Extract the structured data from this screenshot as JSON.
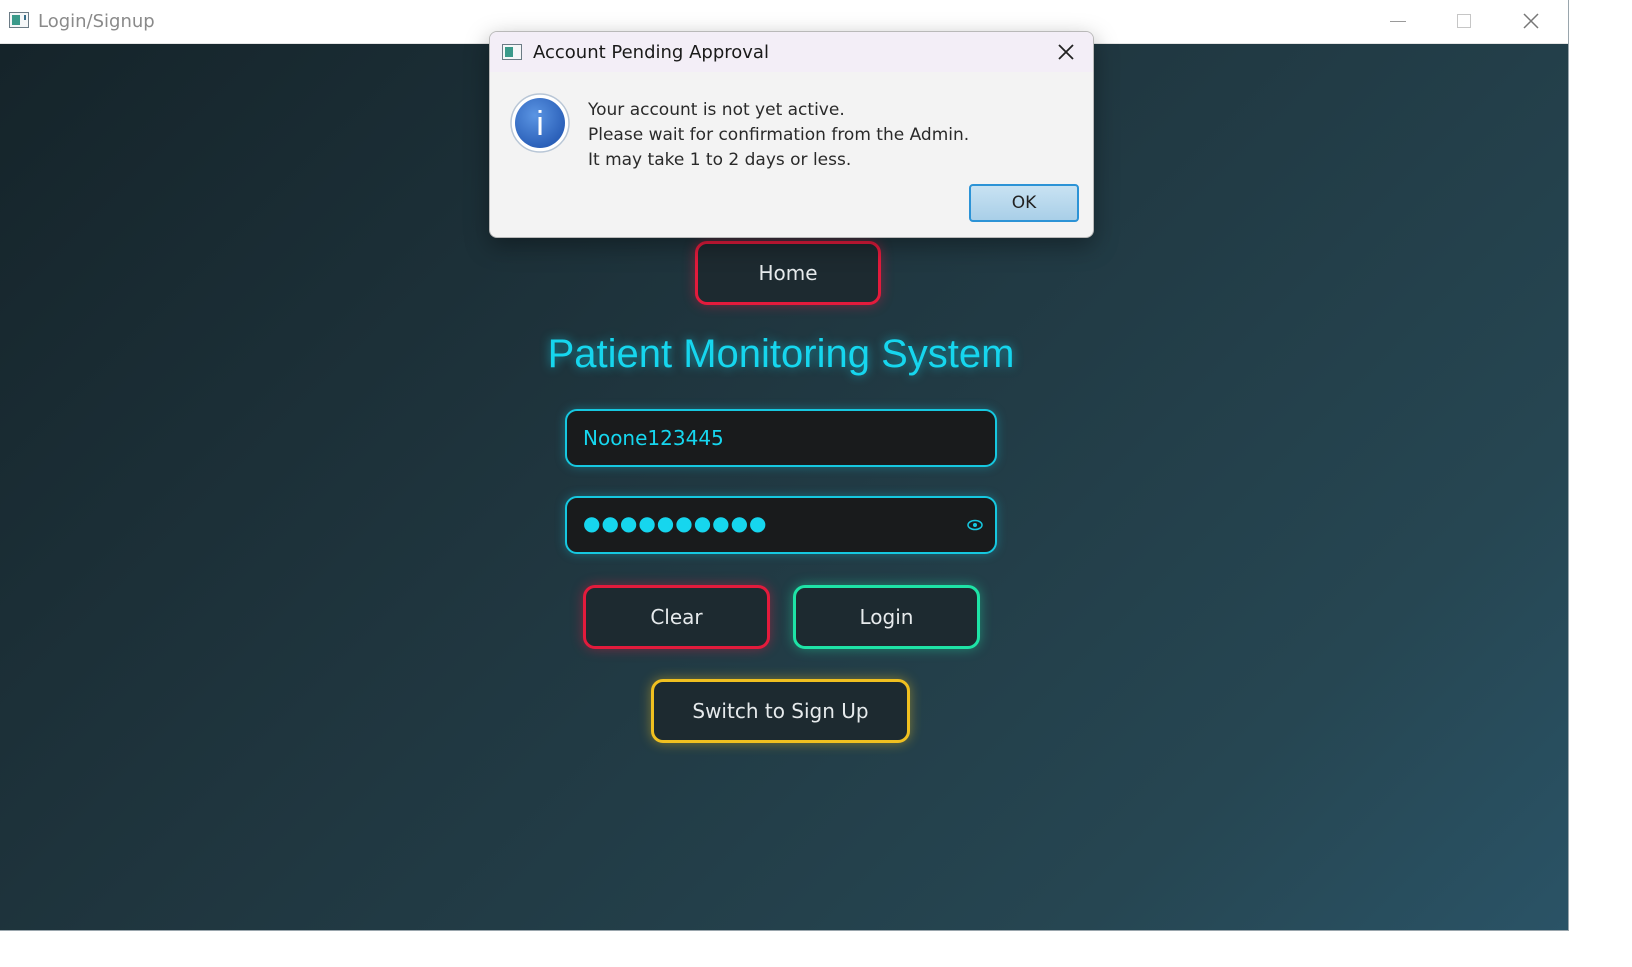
{
  "window": {
    "title": "Login/Signup"
  },
  "app": {
    "home_label": "Home",
    "title": "Patient Monitoring System",
    "username_value": "Noone123445",
    "password_masked": "●●●●●●●●●●",
    "clear_label": "Clear",
    "login_label": "Login",
    "switch_label": "Switch to Sign Up"
  },
  "dialog": {
    "title": "Account Pending Approval",
    "messages": [
      "Your account is not yet active.",
      "Please wait for confirmation from the Admin.",
      "It may take 1 to 2 days or less."
    ],
    "ok_label": "OK"
  },
  "icons": {
    "info": "info-icon",
    "eye": "eye-icon",
    "close": "close-icon"
  },
  "colors": {
    "accent_cyan": "#16d6ee",
    "red": "#e31b3c",
    "green": "#1ee3a6",
    "yellow": "#f0c020",
    "info_blue": "#2f6fc9"
  }
}
